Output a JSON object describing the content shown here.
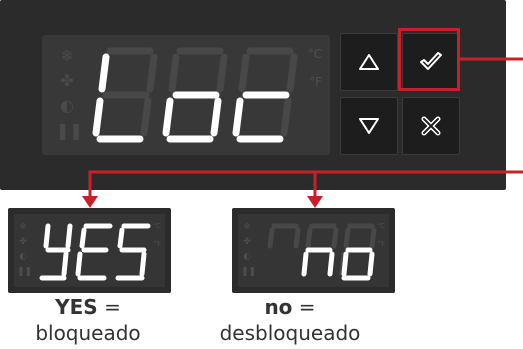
{
  "display": {
    "main_text": "Loc",
    "unit_c": "°C",
    "unit_f": "°F"
  },
  "buttons": {
    "up": "up",
    "confirm": "confirm",
    "down": "down",
    "cancel": "cancel"
  },
  "options": [
    {
      "display": "YES",
      "value": "YES",
      "equals": "=",
      "meaning": "bloqueado"
    },
    {
      "display": "no",
      "value": "no",
      "equals": "=",
      "meaning": "desbloqueado"
    }
  ],
  "colors": {
    "panel": "#2b2b2b",
    "segment_on": "#ffffff",
    "segment_off": "#484848",
    "highlight": "#c8202b"
  }
}
